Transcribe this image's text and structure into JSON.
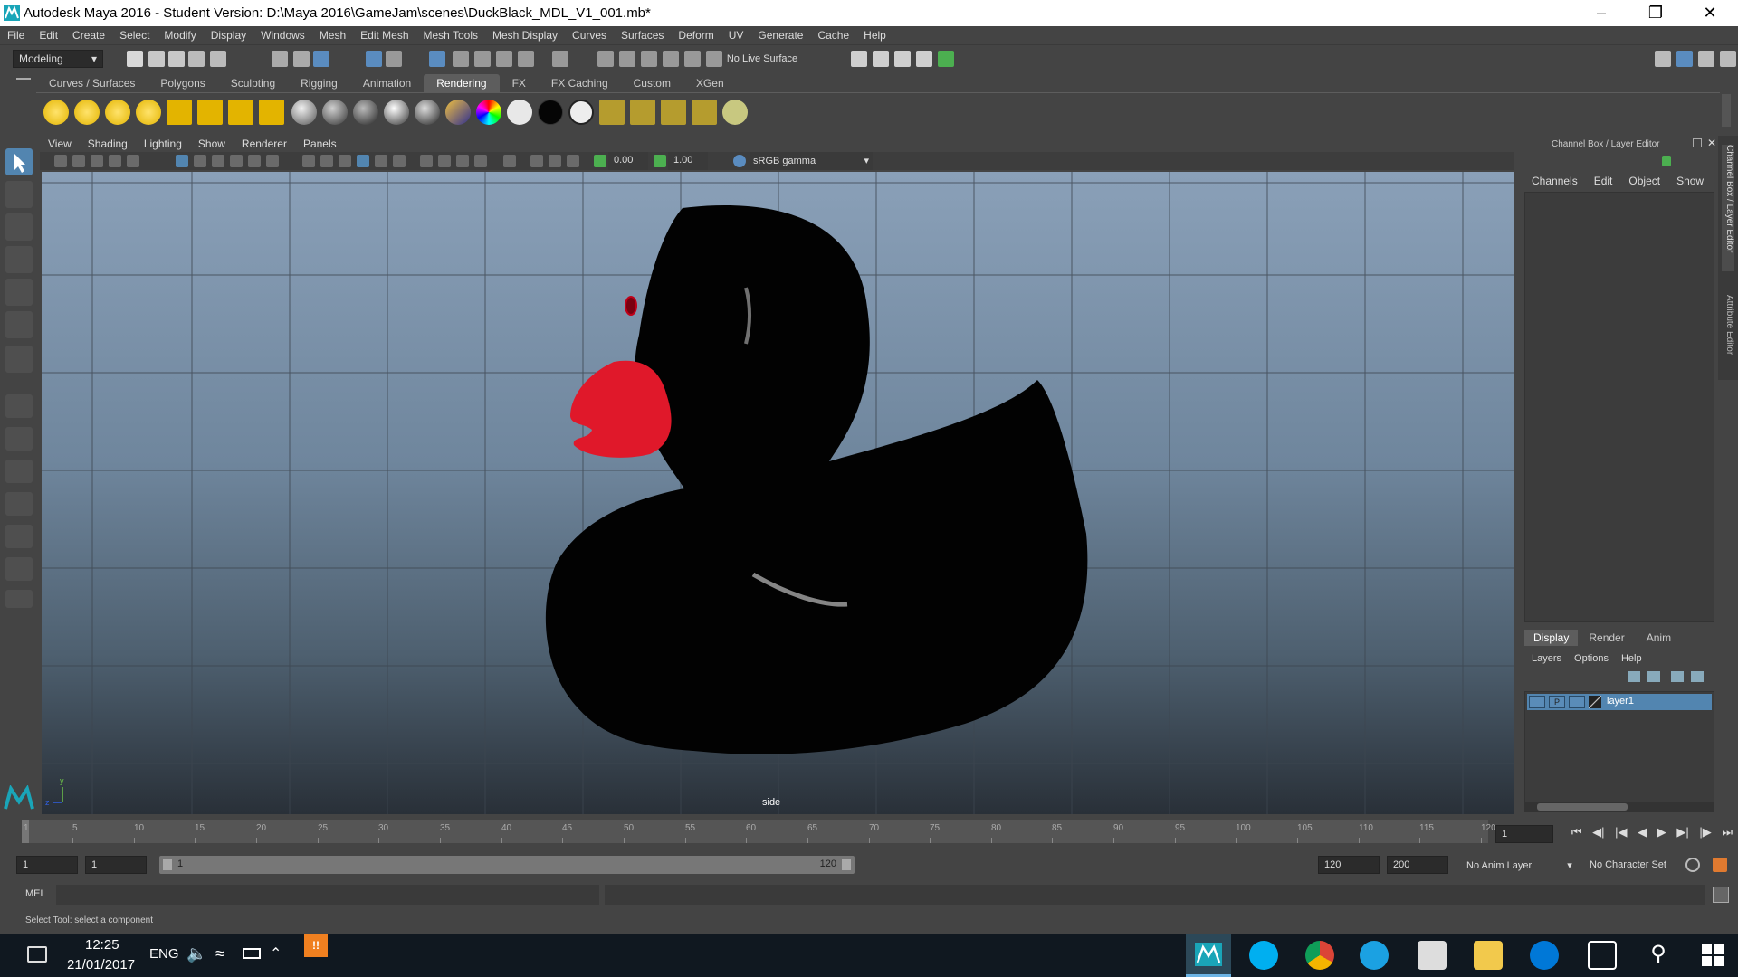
{
  "window": {
    "title": "Autodesk Maya 2016 - Student Version: D:\\Maya 2016\\GameJam\\scenes\\DuckBlack_MDL_V1_001.mb*"
  },
  "menus": [
    "File",
    "Edit",
    "Create",
    "Select",
    "Modify",
    "Display",
    "Windows",
    "Mesh",
    "Edit Mesh",
    "Mesh Tools",
    "Mesh Display",
    "Curves",
    "Surfaces",
    "Deform",
    "UV",
    "Generate",
    "Cache",
    "Help"
  ],
  "statusline": {
    "mode": "Modeling",
    "live_surface": "No Live Surface"
  },
  "shelf_tabs": [
    "Curves / Surfaces",
    "Polygons",
    "Sculpting",
    "Rigging",
    "Animation",
    "Rendering",
    "FX",
    "FX Caching",
    "Custom",
    "XGen"
  ],
  "active_shelf_tab": "Rendering",
  "panel_menu": [
    "View",
    "Shading",
    "Lighting",
    "Show",
    "Renderer",
    "Panels"
  ],
  "panel_toolbar": {
    "exposure": "0.00",
    "gamma": "1.00",
    "colorspace": "sRGB gamma"
  },
  "viewport": {
    "camera_label": "side",
    "axis_y": "y",
    "axis_z": "z"
  },
  "channel_box": {
    "title": "Channel Box / Layer Editor",
    "menu": [
      "Channels",
      "Edit",
      "Object",
      "Show"
    ],
    "side_tabs": [
      "Channel Box / Layer Editor",
      "Attribute Editor"
    ]
  },
  "layer_editor": {
    "tabs": [
      "Display",
      "Render",
      "Anim"
    ],
    "active_tab": "Display",
    "menu": [
      "Layers",
      "Options",
      "Help"
    ],
    "layers": [
      {
        "v": "V",
        "p": "P",
        "name": "layer1"
      }
    ]
  },
  "timeline": {
    "ticks": [
      "1",
      "5",
      "10",
      "15",
      "20",
      "25",
      "30",
      "35",
      "40",
      "45",
      "50",
      "55",
      "60",
      "65",
      "70",
      "75",
      "80",
      "85",
      "90",
      "95",
      "100",
      "105",
      "110",
      "115",
      "120"
    ],
    "current_frame": "1"
  },
  "range": {
    "start": "1",
    "playback_start": "1",
    "slider_start": "1",
    "slider_end": "120",
    "playback_end": "120",
    "end": "200",
    "anim_layer": "No Anim Layer",
    "char_set": "No Character Set"
  },
  "cmdline": {
    "label": "MEL"
  },
  "helpline": {
    "text": "Select Tool: select a component"
  },
  "taskbar": {
    "time": "12:25",
    "date": "21/01/2017",
    "lang": "ENG",
    "notif_count": "!!"
  },
  "colors": {
    "duck_body": "#000000",
    "duck_beak": "#e0182a",
    "viewport_top": "#8aa0b8",
    "active_layer": "#5285b0"
  }
}
